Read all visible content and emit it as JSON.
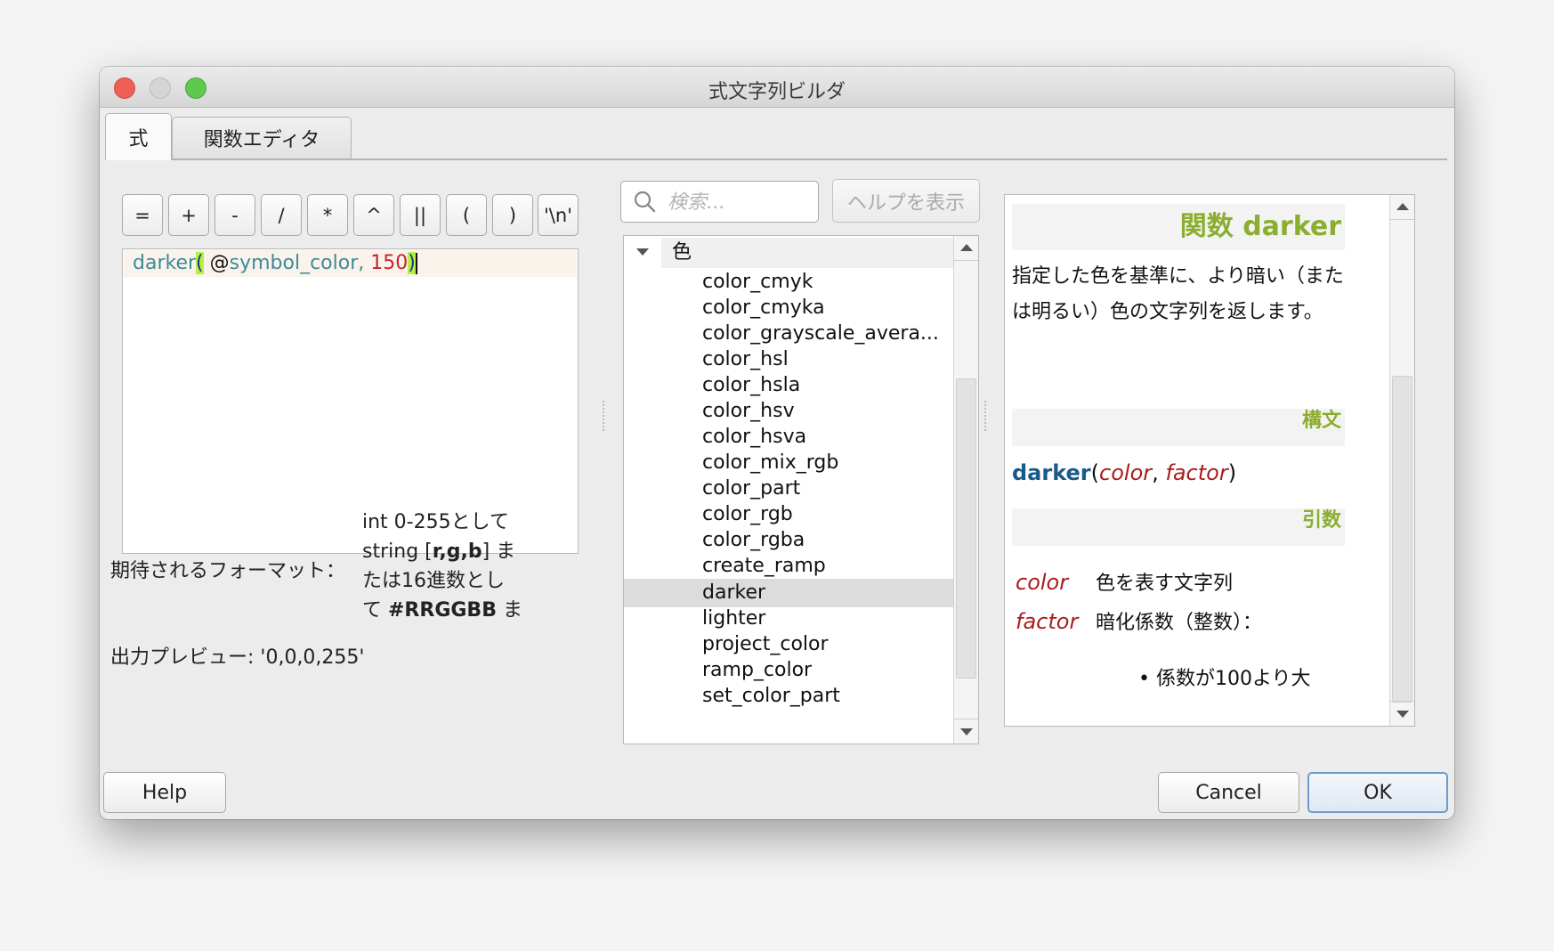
{
  "window": {
    "title": "式文字列ビルダ"
  },
  "tabs": [
    {
      "label": "式",
      "active": true
    },
    {
      "label": "関数エディタ",
      "active": false
    }
  ],
  "operators": [
    "=",
    "+",
    "-",
    "/",
    "*",
    "^",
    "||",
    "(",
    ")",
    "'\\n'"
  ],
  "editor": {
    "tokens": {
      "fn": "darker",
      "open": "(",
      "space": " ",
      "at": "@",
      "var": "symbol_color",
      "comma": ", ",
      "num": "150",
      "close": ")"
    },
    "expression": "darker( @symbol_color, 150)"
  },
  "format": {
    "label": "期待されるフォーマット：",
    "value_lines": [
      {
        "pre": "int 0-255として",
        "bold": "",
        "post": ""
      },
      {
        "pre": "string [",
        "bold": "r,g,b",
        "post": "] ま"
      },
      {
        "pre": "たは16進数とし",
        "bold": "",
        "post": ""
      },
      {
        "pre": "て ",
        "bold": "#RRGGBB",
        "post": " ま"
      }
    ]
  },
  "preview": {
    "text": "出力プレビュー: '0,0,0,255'"
  },
  "search": {
    "placeholder": "検索...",
    "value": ""
  },
  "show_help_button": "ヘルプを表示",
  "tree": {
    "group": "色",
    "expanded": true,
    "items": [
      "color_cmyk",
      "color_cmyka",
      "color_grayscale_avera...",
      "color_hsl",
      "color_hsla",
      "color_hsv",
      "color_hsva",
      "color_mix_rgb",
      "color_part",
      "color_rgb",
      "color_rgba",
      "create_ramp",
      "darker",
      "lighter",
      "project_color",
      "ramp_color",
      "set_color_part"
    ],
    "selected": "darker"
  },
  "help": {
    "title": "関数 darker",
    "description": "指定した色を基準に、より暗い（または明るい）色の文字列を返します。",
    "syntax_header": "構文",
    "syntax": {
      "fn": "darker",
      "open": "(",
      "arg1": "color",
      "sep": ", ",
      "arg2": "factor",
      "close": ")"
    },
    "args_header": "引数",
    "args": [
      {
        "name": "color",
        "desc": "色を表す文字列"
      },
      {
        "name": "factor",
        "desc": "暗化係数（整数）："
      }
    ],
    "bullet": "• 係数が100より大"
  },
  "buttons": {
    "help": "Help",
    "cancel": "Cancel",
    "ok": "OK"
  },
  "colors": {
    "header_green": "#8cae2e",
    "syntax_blue": "#1a5a8a",
    "arg_red": "#a81d1d",
    "token_teal": "#3e8a97",
    "token_number": "#c5242a"
  }
}
